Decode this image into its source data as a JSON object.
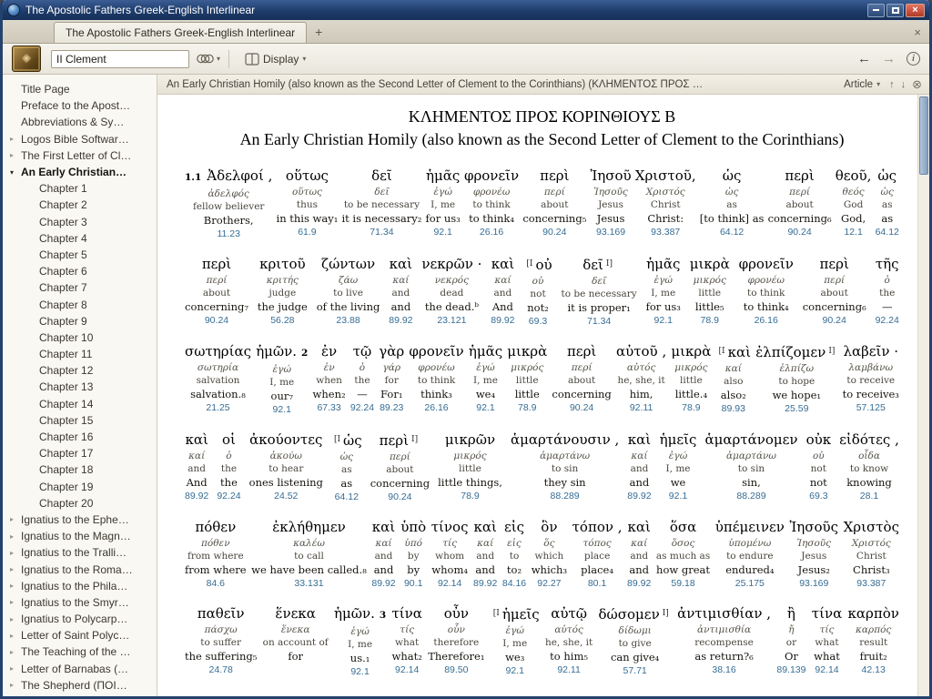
{
  "window": {
    "title": "The Apostolic Fathers Greek-English Interlinear"
  },
  "icons": {
    "close": "×",
    "plus": "+",
    "pane_close": "×",
    "caret_down": "▾",
    "back": "←",
    "forward": "→",
    "info": "i",
    "nav_up": "↑",
    "nav_down": "↓",
    "locator_close": "⊗",
    "tree_collapsed": "▸",
    "tree_expanded": "▾"
  },
  "tabbar": {
    "active_tab": "The Apostolic Fathers Greek-English Interlinear"
  },
  "toolbar": {
    "search_value": "II Clement",
    "display_label": "Display"
  },
  "locator": {
    "text": "An Early Christian Homily (also known as the Second Letter of Clement to the Corinthians) (ΚΛΗΜΕΝΤΟΣ ΠΡΟΣ …",
    "article_label": "Article"
  },
  "sidebar": {
    "items": [
      {
        "label": "Title Page",
        "arrow": null,
        "indent": 0
      },
      {
        "label": "Preface to the Apost…",
        "arrow": null,
        "indent": 0
      },
      {
        "label": "Abbreviations & Sy…",
        "arrow": null,
        "indent": 0
      },
      {
        "label": "Logos Bible Softwar…",
        "arrow": "right",
        "indent": 0
      },
      {
        "label": "The First Letter of Cl…",
        "arrow": "right",
        "indent": 0
      },
      {
        "label": "An Early Christian…",
        "arrow": "down",
        "indent": 0,
        "selected": true
      },
      {
        "label": "Chapter 1",
        "arrow": null,
        "indent": 1
      },
      {
        "label": "Chapter 2",
        "arrow": null,
        "indent": 1
      },
      {
        "label": "Chapter 3",
        "arrow": null,
        "indent": 1
      },
      {
        "label": "Chapter 4",
        "arrow": null,
        "indent": 1
      },
      {
        "label": "Chapter 5",
        "arrow": null,
        "indent": 1
      },
      {
        "label": "Chapter 6",
        "arrow": null,
        "indent": 1
      },
      {
        "label": "Chapter 7",
        "arrow": null,
        "indent": 1
      },
      {
        "label": "Chapter 8",
        "arrow": null,
        "indent": 1
      },
      {
        "label": "Chapter 9",
        "arrow": null,
        "indent": 1
      },
      {
        "label": "Chapter 10",
        "arrow": null,
        "indent": 1
      },
      {
        "label": "Chapter 11",
        "arrow": null,
        "indent": 1
      },
      {
        "label": "Chapter 12",
        "arrow": null,
        "indent": 1
      },
      {
        "label": "Chapter 13",
        "arrow": null,
        "indent": 1
      },
      {
        "label": "Chapter 14",
        "arrow": null,
        "indent": 1
      },
      {
        "label": "Chapter 15",
        "arrow": null,
        "indent": 1
      },
      {
        "label": "Chapter 16",
        "arrow": null,
        "indent": 1
      },
      {
        "label": "Chapter 17",
        "arrow": null,
        "indent": 1
      },
      {
        "label": "Chapter 18",
        "arrow": null,
        "indent": 1
      },
      {
        "label": "Chapter 19",
        "arrow": null,
        "indent": 1
      },
      {
        "label": "Chapter 20",
        "arrow": null,
        "indent": 1
      },
      {
        "label": "Ignatius to the Ephe…",
        "arrow": "right",
        "indent": 0
      },
      {
        "label": "Ignatius to the Magn…",
        "arrow": "right",
        "indent": 0
      },
      {
        "label": "Ignatius to the Tralli…",
        "arrow": "right",
        "indent": 0
      },
      {
        "label": "Ignatius to the Roma…",
        "arrow": "right",
        "indent": 0
      },
      {
        "label": "Ignatius to the Phila…",
        "arrow": "right",
        "indent": 0
      },
      {
        "label": "Ignatius to the Smyr…",
        "arrow": "right",
        "indent": 0
      },
      {
        "label": "Ignatius to Polycarp…",
        "arrow": "right",
        "indent": 0
      },
      {
        "label": "Letter of Saint Polyc…",
        "arrow": "right",
        "indent": 0
      },
      {
        "label": "The Teaching of the …",
        "arrow": "right",
        "indent": 0
      },
      {
        "label": "Letter of Barnabas (…",
        "arrow": "right",
        "indent": 0
      },
      {
        "label": "The Shepherd (ΠΟΙ…",
        "arrow": "right",
        "indent": 0
      }
    ]
  },
  "content": {
    "title_greek": "ΚΛΗΜΕΝΤΟΣ ΠΡΟΣ ΚΟΡΙΝΘΙΟΥΣ Β",
    "title_english": "An Early Christian Homily (also known as the Second Letter of Clement to the Corinthians)",
    "rows": [
      {
        "words": [
          {
            "v": "1.1",
            "g": "Ἀδελφοί ,",
            "l": "ἀδελφός",
            "e1": "fellow believer",
            "e2": "Brothers,",
            "n": "11.23"
          },
          {
            "g": "οὕτως",
            "l": "οὕτως",
            "e1": "thus",
            "e2": "in this way₁",
            "n": "61.9"
          },
          {
            "g": "δεῖ",
            "l": "δεῖ",
            "e1": "to be necessary",
            "e2": "it is necessary₂",
            "n": "71.34"
          },
          {
            "g": "ἡμᾶς",
            "l": "ἐγώ",
            "e1": "I, me",
            "e2": "for us₃",
            "n": "92.1"
          },
          {
            "g": "φρονεῖν",
            "l": "φρονέω",
            "e1": "to think",
            "e2": "to think₄",
            "n": "26.16"
          },
          {
            "g": "περὶ",
            "l": "περί",
            "e1": "about",
            "e2": "concerning₅",
            "n": "90.24"
          },
          {
            "g": "Ἰησοῦ",
            "l": "Ἰησοῦς",
            "e1": "Jesus",
            "e2": "Jesus",
            "n": "93.169"
          },
          {
            "g": "Χριστοῦ,",
            "l": "Χριστός",
            "e1": "Christ",
            "e2": "Christ:",
            "n": "93.387"
          },
          {
            "g": "ὡς",
            "l": "ὡς",
            "e1": "as",
            "e2": "[to think] as",
            "n": "64.12"
          },
          {
            "g": "περὶ",
            "l": "περί",
            "e1": "about",
            "e2": "concerning₆",
            "n": "90.24"
          },
          {
            "g": "θεοῦ,",
            "l": "θεός",
            "e1": "God",
            "e2": "God,",
            "n": "12.1"
          },
          {
            "g": "ὡς",
            "l": "ὡς",
            "e1": "as",
            "e2": "as",
            "n": "64.12"
          }
        ]
      },
      {
        "words": [
          {
            "g": "περὶ",
            "l": "περί",
            "e1": "about",
            "e2": "concerning₇",
            "n": "90.24"
          },
          {
            "g": "κριτοῦ",
            "l": "κριτής",
            "e1": "judge",
            "e2": "the judge",
            "n": "56.28"
          },
          {
            "g": "ζώντων",
            "l": "ζάω",
            "e1": "to live",
            "e2": "of the living",
            "n": "23.88"
          },
          {
            "g": "καὶ",
            "l": "καί",
            "e1": "and",
            "e2": "and",
            "n": "89.92"
          },
          {
            "g": "νεκρῶν ·",
            "l": "νεκρός",
            "e1": "dead",
            "e2": "the dead.ᵇ",
            "n": "23.121"
          },
          {
            "g": "καὶ",
            "l": "καί",
            "e1": "and",
            "e2": "And",
            "n": "89.92"
          },
          {
            "m1": "[I",
            "g": "οὐ",
            "l": "οὐ",
            "e1": "not",
            "e2": "not₂",
            "n": "69.3"
          },
          {
            "g": "δεῖ",
            "m2": "I]",
            "l": "δεῖ",
            "e1": "to be necessary",
            "e2": "it is proper₁",
            "n": "71.34"
          },
          {
            "g": "ἡμᾶς",
            "l": "ἐγώ",
            "e1": "I, me",
            "e2": "for us₃",
            "n": "92.1"
          },
          {
            "g": "μικρὰ",
            "l": "μικρός",
            "e1": "little",
            "e2": "little₅",
            "n": "78.9"
          },
          {
            "g": "φρονεῖν",
            "l": "φρονέω",
            "e1": "to think",
            "e2": "to think₄",
            "n": "26.16"
          },
          {
            "g": "περὶ",
            "l": "περί",
            "e1": "about",
            "e2": "concerning₆",
            "n": "90.24"
          },
          {
            "g": "τῆς",
            "l": "ὁ",
            "e1": "the",
            "e2": "—",
            "n": "92.24"
          }
        ]
      },
      {
        "words": [
          {
            "g": "σωτηρίας",
            "l": "σωτηρία",
            "e1": "salvation",
            "e2": "salvation.₈",
            "n": "21.25"
          },
          {
            "g": "ἡμῶν.",
            "vafter": "2",
            "l": "ἐγώ",
            "e1": "I, me",
            "e2": "our₇",
            "n": "92.1"
          },
          {
            "g": "ἐν",
            "l": "ἐν",
            "e1": "when",
            "e2": "when₂",
            "n": "67.33"
          },
          {
            "g": "τῷ",
            "l": "ὁ",
            "e1": "the",
            "e2": "—",
            "n": "92.24"
          },
          {
            "g": "γὰρ",
            "l": "γάρ",
            "e1": "for",
            "e2": "For₁",
            "n": "89.23"
          },
          {
            "g": "φρονεῖν",
            "l": "φρονέω",
            "e1": "to think",
            "e2": "think₃",
            "n": "26.16"
          },
          {
            "g": "ἡμᾶς",
            "l": "ἐγώ",
            "e1": "I, me",
            "e2": "we₄",
            "n": "92.1"
          },
          {
            "g": "μικρὰ",
            "l": "μικρός",
            "e1": "little",
            "e2": "little",
            "n": "78.9"
          },
          {
            "g": "περὶ",
            "l": "περί",
            "e1": "about",
            "e2": "concerning",
            "n": "90.24"
          },
          {
            "g": "αὐτοῦ ,",
            "l": "αὐτός",
            "e1": "he, she, it",
            "e2": "him,",
            "n": "92.11"
          },
          {
            "g": "μικρὰ",
            "l": "μικρός",
            "e1": "little",
            "e2": "little.₄",
            "n": "78.9"
          },
          {
            "m1": "[I",
            "g": "καὶ",
            "l": "καί",
            "e1": "also",
            "e2": "also₂",
            "n": "89.93"
          },
          {
            "g": "ἐλπίζομεν",
            "m2": "I]",
            "l": "ἐλπίζω",
            "e1": "to hope",
            "e2": "we hope₁",
            "n": "25.59"
          },
          {
            "g": "λαβεῖν ·",
            "l": "λαμβάνω",
            "e1": "to receive",
            "e2": "to receive₃",
            "n": "57.125"
          }
        ]
      },
      {
        "words": [
          {
            "g": "καὶ",
            "l": "καί",
            "e1": "and",
            "e2": "And",
            "n": "89.92"
          },
          {
            "g": "οἱ",
            "l": "ὁ",
            "e1": "the",
            "e2": "the",
            "n": "92.24"
          },
          {
            "g": "ἀκούοντες",
            "l": "ἀκούω",
            "e1": "to hear",
            "e2": "ones listening",
            "n": "24.52"
          },
          {
            "m1": "[I",
            "g": "ὡς",
            "l": "ὡς",
            "e1": "as",
            "e2": "as",
            "n": "64.12"
          },
          {
            "g": "περὶ",
            "m2": "I]",
            "l": "περί",
            "e1": "about",
            "e2": "concerning",
            "n": "90.24"
          },
          {
            "g": "μικρῶν",
            "l": "μικρός",
            "e1": "little",
            "e2": "little things,",
            "n": "78.9"
          },
          {
            "g": "ἁμαρτάνουσιν ,",
            "l": "ἁμαρτάνω",
            "e1": "to sin",
            "e2": "they sin",
            "n": "88.289"
          },
          {
            "g": "καὶ",
            "l": "καί",
            "e1": "and",
            "e2": "and",
            "n": "89.92"
          },
          {
            "g": "ἡμεῖς",
            "l": "ἐγώ",
            "e1": "I, me",
            "e2": "we",
            "n": "92.1"
          },
          {
            "g": "ἁμαρτάνομεν",
            "l": "ἁμαρτάνω",
            "e1": "to sin",
            "e2": "sin,",
            "n": "88.289"
          },
          {
            "g": "οὐκ",
            "l": "οὐ",
            "e1": "not",
            "e2": "not",
            "n": "69.3"
          },
          {
            "g": "εἰδότες ,",
            "l": "οἶδα",
            "e1": "to know",
            "e2": "knowing",
            "n": "28.1"
          }
        ]
      },
      {
        "words": [
          {
            "g": "πόθεν",
            "l": "πόθεν",
            "e1": "from where",
            "e2": "from where",
            "n": "84.6"
          },
          {
            "g": "ἐκλήθημεν",
            "l": "καλέω",
            "e1": "to call",
            "e2": "we have been called.₈",
            "n": "33.131"
          },
          {
            "g": "καὶ",
            "l": "καί",
            "e1": "and",
            "e2": "and",
            "n": "89.92"
          },
          {
            "g": "ὑπὸ",
            "l": "ὑπό",
            "e1": "by",
            "e2": "by",
            "n": "90.1"
          },
          {
            "g": "τίνος",
            "l": "τίς",
            "e1": "whom",
            "e2": "whom₄",
            "n": "92.14"
          },
          {
            "g": "καὶ",
            "l": "καί",
            "e1": "and",
            "e2": "and",
            "n": "89.92"
          },
          {
            "g": "εἰς",
            "l": "εἰς",
            "e1": "to",
            "e2": "to₂",
            "n": "84.16"
          },
          {
            "g": "ὃν",
            "l": "ὅς",
            "e1": "which",
            "e2": "which₃",
            "n": "92.27"
          },
          {
            "g": "τόπον ,",
            "l": "τόπος",
            "e1": "place",
            "e2": "place₄",
            "n": "80.1"
          },
          {
            "g": "καὶ",
            "l": "καί",
            "e1": "and",
            "e2": "and",
            "n": "89.92"
          },
          {
            "g": "ὅσα",
            "l": "ὅσος",
            "e1": "as much as",
            "e2": "how great",
            "n": "59.18"
          },
          {
            "g": "ὑπέμεινεν",
            "l": "ὑπομένω",
            "e1": "to endure",
            "e2": "endured₄",
            "n": "25.175"
          },
          {
            "g": "Ἰησοῦς",
            "l": "Ἰησοῦς",
            "e1": "Jesus",
            "e2": "Jesus₂",
            "n": "93.169"
          },
          {
            "g": "Χριστὸς",
            "l": "Χριστός",
            "e1": "Christ",
            "e2": "Christ₃",
            "n": "93.387"
          }
        ]
      },
      {
        "words": [
          {
            "g": "παθεῖν",
            "l": "πάσχω",
            "e1": "to suffer",
            "e2": "the suffering₅",
            "n": "24.78"
          },
          {
            "g": "ἕνεκα",
            "l": "ἕνεκα",
            "e1": "on account of",
            "e2": "for",
            "n": ""
          },
          {
            "g": "ἡμῶν.",
            "vafter": "3",
            "l": "ἐγώ",
            "e1": "I, me",
            "e2": "us.₁",
            "n": "92.1"
          },
          {
            "g": "τίνα",
            "l": "τίς",
            "e1": "what",
            "e2": "what₂",
            "n": "92.14"
          },
          {
            "g": "οὖν",
            "l": "οὖν",
            "e1": "therefore",
            "e2": "Therefore₁",
            "n": "89.50"
          },
          {
            "m1": "[I",
            "g": "ἡμεῖς",
            "l": "ἐγώ",
            "e1": "I, me",
            "e2": "we₃",
            "n": "92.1"
          },
          {
            "g": "αὐτῷ",
            "l": "αὐτός",
            "e1": "he, she, it",
            "e2": "to him₅",
            "n": "92.11"
          },
          {
            "g": "δώσομεν",
            "m2": "I]",
            "l": "δίδωμι",
            "e1": "to give",
            "e2": "can give₄",
            "n": "57.71"
          },
          {
            "g": "ἀντιμισθίαν ,",
            "l": "ἀντιμισθία",
            "e1": "recompense",
            "e2": "as return?₆",
            "n": "38.16"
          },
          {
            "g": "ἢ",
            "l": "ἤ",
            "e1": "or",
            "e2": "Or",
            "n": "89.139"
          },
          {
            "g": "τίνα",
            "l": "τίς",
            "e1": "what",
            "e2": "what",
            "n": "92.14"
          },
          {
            "g": "καρπὸν",
            "l": "καρπός",
            "e1": "result",
            "e2": "fruit₂",
            "n": "42.13"
          }
        ]
      }
    ]
  }
}
